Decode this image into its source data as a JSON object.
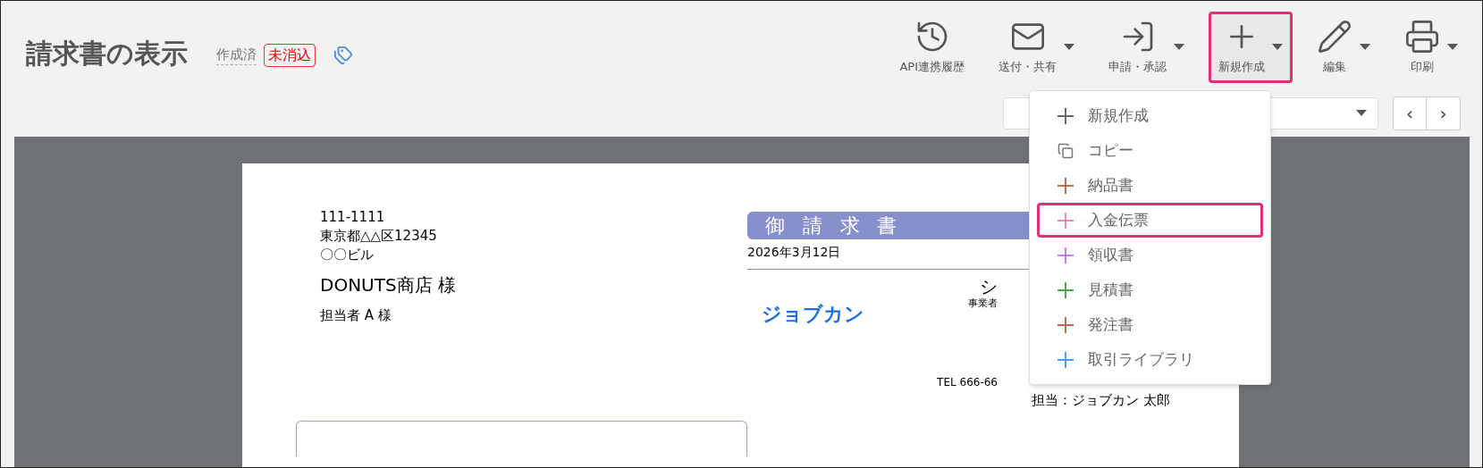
{
  "header": {
    "title": "請求書の表示",
    "status": "作成済",
    "badge": "未消込"
  },
  "toolbar": [
    {
      "kind": "history",
      "label": "API連携履歴",
      "has_menu": false,
      "selected": false
    },
    {
      "kind": "mail",
      "label": "送付・共有",
      "has_menu": true,
      "selected": false
    },
    {
      "kind": "submit",
      "label": "申請・承認",
      "has_menu": true,
      "selected": false
    },
    {
      "kind": "plus",
      "label": "新規作成",
      "has_menu": true,
      "selected": true
    },
    {
      "kind": "pencil",
      "label": "編集",
      "has_menu": true,
      "selected": false
    },
    {
      "kind": "printer",
      "label": "印刷",
      "has_menu": true,
      "selected": false
    }
  ],
  "pager": {
    "prev": "‹",
    "next": "›"
  },
  "dropdown": [
    {
      "kind": "plus",
      "label": "新規作成",
      "color": "#666666",
      "selected": false
    },
    {
      "kind": "copy",
      "label": "コピー",
      "color": "#777777",
      "selected": false
    },
    {
      "kind": "plus",
      "label": "納品書",
      "color": "#b8704c",
      "selected": false
    },
    {
      "kind": "plus",
      "label": "入金伝票",
      "color": "#e88aa8",
      "selected": true
    },
    {
      "kind": "plus",
      "label": "領収書",
      "color": "#c77de0",
      "selected": false
    },
    {
      "kind": "plus",
      "label": "見積書",
      "color": "#45a845",
      "selected": false
    },
    {
      "kind": "plus",
      "label": "発注書",
      "color": "#b8704c",
      "selected": false
    },
    {
      "kind": "plus",
      "label": "取引ライブラリ",
      "color": "#4a9be8",
      "selected": false
    }
  ],
  "document": {
    "recipient_address": [
      "111-1111",
      "東京都△△区12345",
      "〇〇ビル"
    ],
    "recipient_name": "DONUTS商店 様",
    "recipient_contact": "担当者 A 様",
    "doc_title": "御請求書",
    "date": "2026年3月12日",
    "logo": "ジョブカン",
    "issuer_name": "シ",
    "issuer_label": "事業者",
    "issuer_tel": "TEL 666-66",
    "issuer_contact": "担当：ジョブカン 太郎"
  }
}
